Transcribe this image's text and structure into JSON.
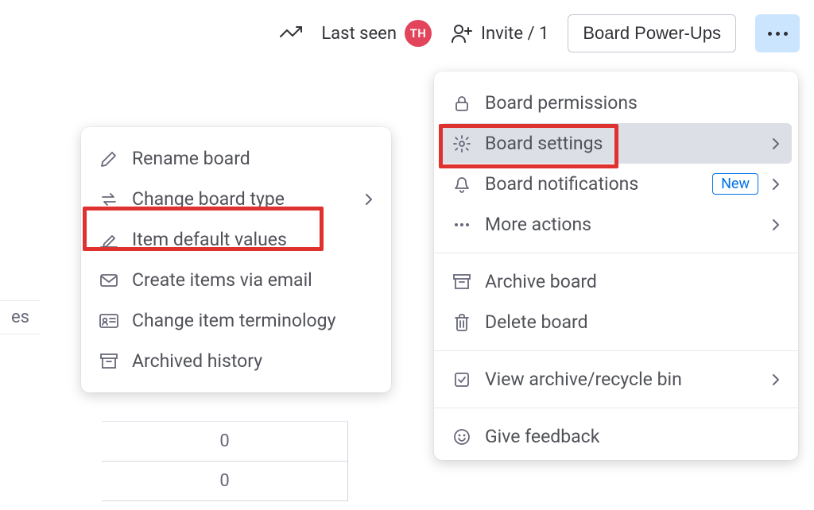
{
  "toolbar": {
    "last_seen": "Last seen",
    "avatar_initials": "TH",
    "invite_label": "Invite / 1",
    "power_ups": "Board Power-Ups"
  },
  "bg": {
    "label_fragment": "es",
    "num_a": "0",
    "num_b": "0"
  },
  "menu_left": {
    "rename": "Rename board",
    "change_type": "Change board type",
    "item_defaults": "Item default values",
    "create_email": "Create items via email",
    "terminology": "Change item terminology",
    "archived": "Archived history"
  },
  "menu_right": {
    "permissions": "Board permissions",
    "settings": "Board settings",
    "notifications": "Board notifications",
    "notifications_badge": "New",
    "more_actions": "More actions",
    "archive": "Archive board",
    "delete": "Delete board",
    "view_archive": "View archive/recycle bin",
    "feedback": "Give feedback"
  }
}
